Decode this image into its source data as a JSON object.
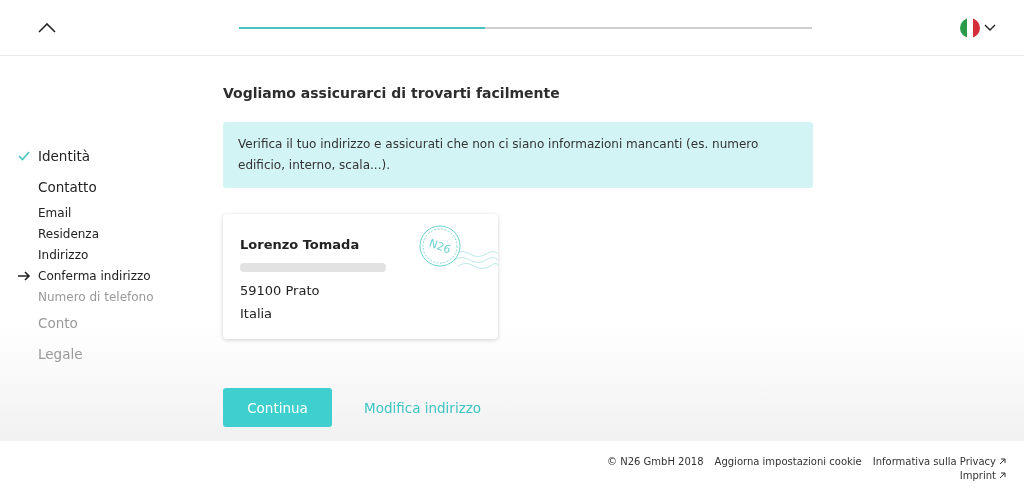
{
  "header": {
    "progress": {
      "level": 0.43
    }
  },
  "sidebar": {
    "sections": [
      {
        "label": "Identità",
        "checked": true,
        "disabled": false
      },
      {
        "label": "Contatto",
        "checked": false,
        "disabled": false,
        "children": [
          {
            "label": "Email",
            "current": false,
            "disabled": false
          },
          {
            "label": "Residenza",
            "current": false,
            "disabled": false
          },
          {
            "label": "Indirizzo",
            "current": false,
            "disabled": false
          },
          {
            "label": "Conferma indirizzo",
            "current": true,
            "disabled": false
          },
          {
            "label": "Numero di telefono",
            "current": false,
            "disabled": true
          }
        ]
      },
      {
        "label": "Conto",
        "checked": false,
        "disabled": true
      },
      {
        "label": "Legale",
        "checked": false,
        "disabled": true
      }
    ]
  },
  "content": {
    "title": "Vogliamo assicurarci di trovarti facilmente",
    "notice": "Verifica il tuo indirizzo e assicurati che non ci siano informazioni mancanti (es. numero edificio, interno, scala...).",
    "address_card": {
      "stamp": "N26",
      "lines": [
        {
          "text": "Lorenzo Tomada",
          "kind": "name"
        },
        {
          "kind": "redacted"
        },
        {
          "text": "59100 Prato",
          "kind": "plain"
        },
        {
          "text": "Italia",
          "kind": "plain"
        }
      ]
    },
    "primary_button": "Continua",
    "secondary_link": "Modifica indirizzo"
  },
  "footer": {
    "copyright": "© N26 GmbH 2018",
    "links": [
      {
        "label": "Aggiorna impostazioni cookie",
        "external": false
      },
      {
        "label": "Informativa sulla Privacy",
        "external": true
      },
      {
        "label": "Imprint",
        "external": true
      }
    ]
  }
}
